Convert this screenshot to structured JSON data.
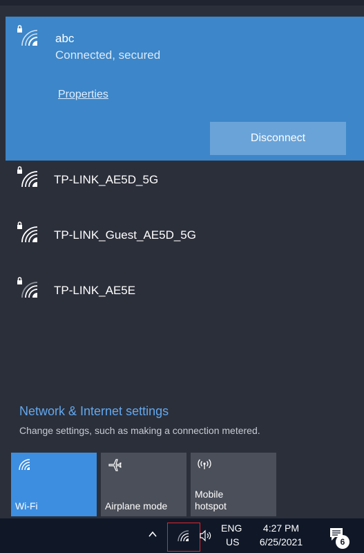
{
  "connected_network": {
    "name": "abc",
    "status": "Connected, secured",
    "properties_label": "Properties",
    "disconnect_label": "Disconnect",
    "icon": "wifi-lock-icon"
  },
  "networks": [
    {
      "name": "TP-LINK_AE5D_5G",
      "icon": "wifi-lock-icon"
    },
    {
      "name": "TP-LINK_Guest_AE5D_5G",
      "icon": "wifi-lock-icon"
    },
    {
      "name": "TP-LINK_AE5E",
      "icon": "wifi-lock-icon"
    }
  ],
  "settings": {
    "title": "Network & Internet settings",
    "subtitle": "Change settings, such as making a connection metered."
  },
  "quick_actions": [
    {
      "label": "Wi-Fi",
      "icon": "wifi-icon",
      "active": true
    },
    {
      "label": "Airplane mode",
      "icon": "airplane-icon",
      "active": false
    },
    {
      "label": "Mobile hotspot",
      "label_line1": "Mobile",
      "label_line2": "hotspot",
      "icon": "hotspot-icon",
      "active": false
    }
  ],
  "taskbar": {
    "language_top": "ENG",
    "language_bottom": "US",
    "time": "4:27 PM",
    "date": "6/25/2021",
    "notification_count": "6"
  },
  "colors": {
    "flyout_bg": "#2b2f3a",
    "connected_bg": "#3c86c9",
    "accent": "#3d8ee0",
    "link": "#63a8ee",
    "highlight_border": "#e0262f"
  }
}
